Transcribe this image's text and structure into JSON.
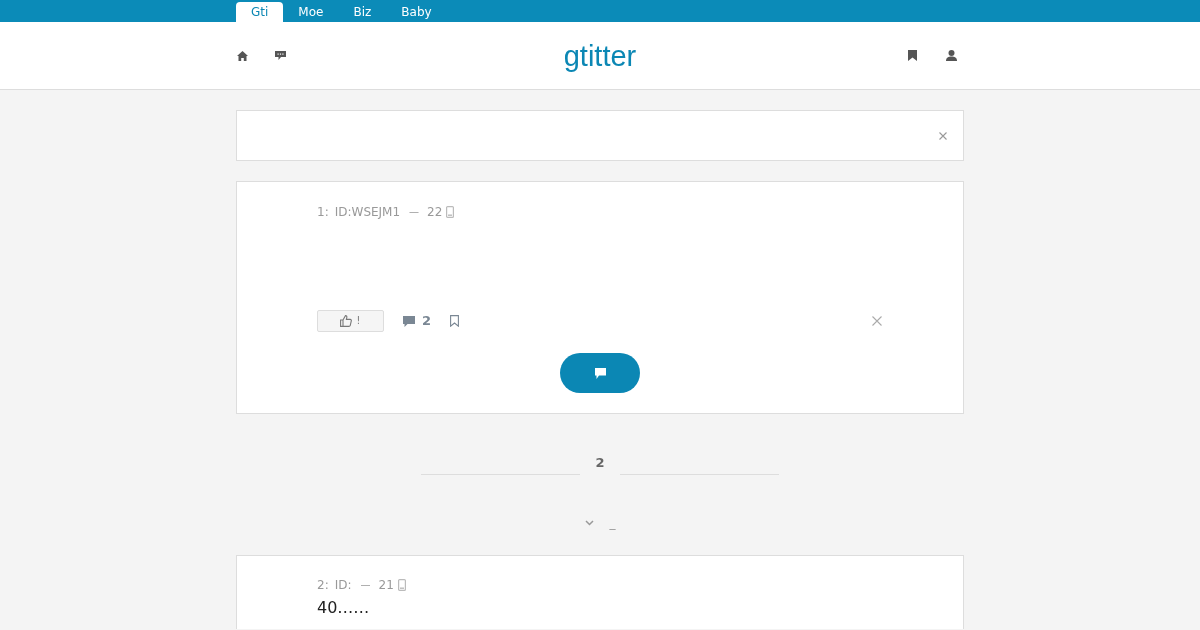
{
  "top_tabs": [
    {
      "label": "Gti",
      "selected": true
    },
    {
      "label": "Moe",
      "selected": false
    },
    {
      "label": "Biz",
      "selected": false
    },
    {
      "label": "Baby",
      "selected": false
    }
  ],
  "header": {
    "logo": "gtitter"
  },
  "posts": [
    {
      "number": "1:",
      "id": "ID:WSEJM1",
      "separator": "—",
      "count": "22",
      "actions": {
        "like_label": "!",
        "comment_count": "2"
      }
    },
    {
      "number": "2:",
      "id": "ID:",
      "separator": "—",
      "count": "21",
      "body": "40……"
    }
  ],
  "page_divider": {
    "label": "2"
  },
  "load_more": {
    "label": "_"
  }
}
